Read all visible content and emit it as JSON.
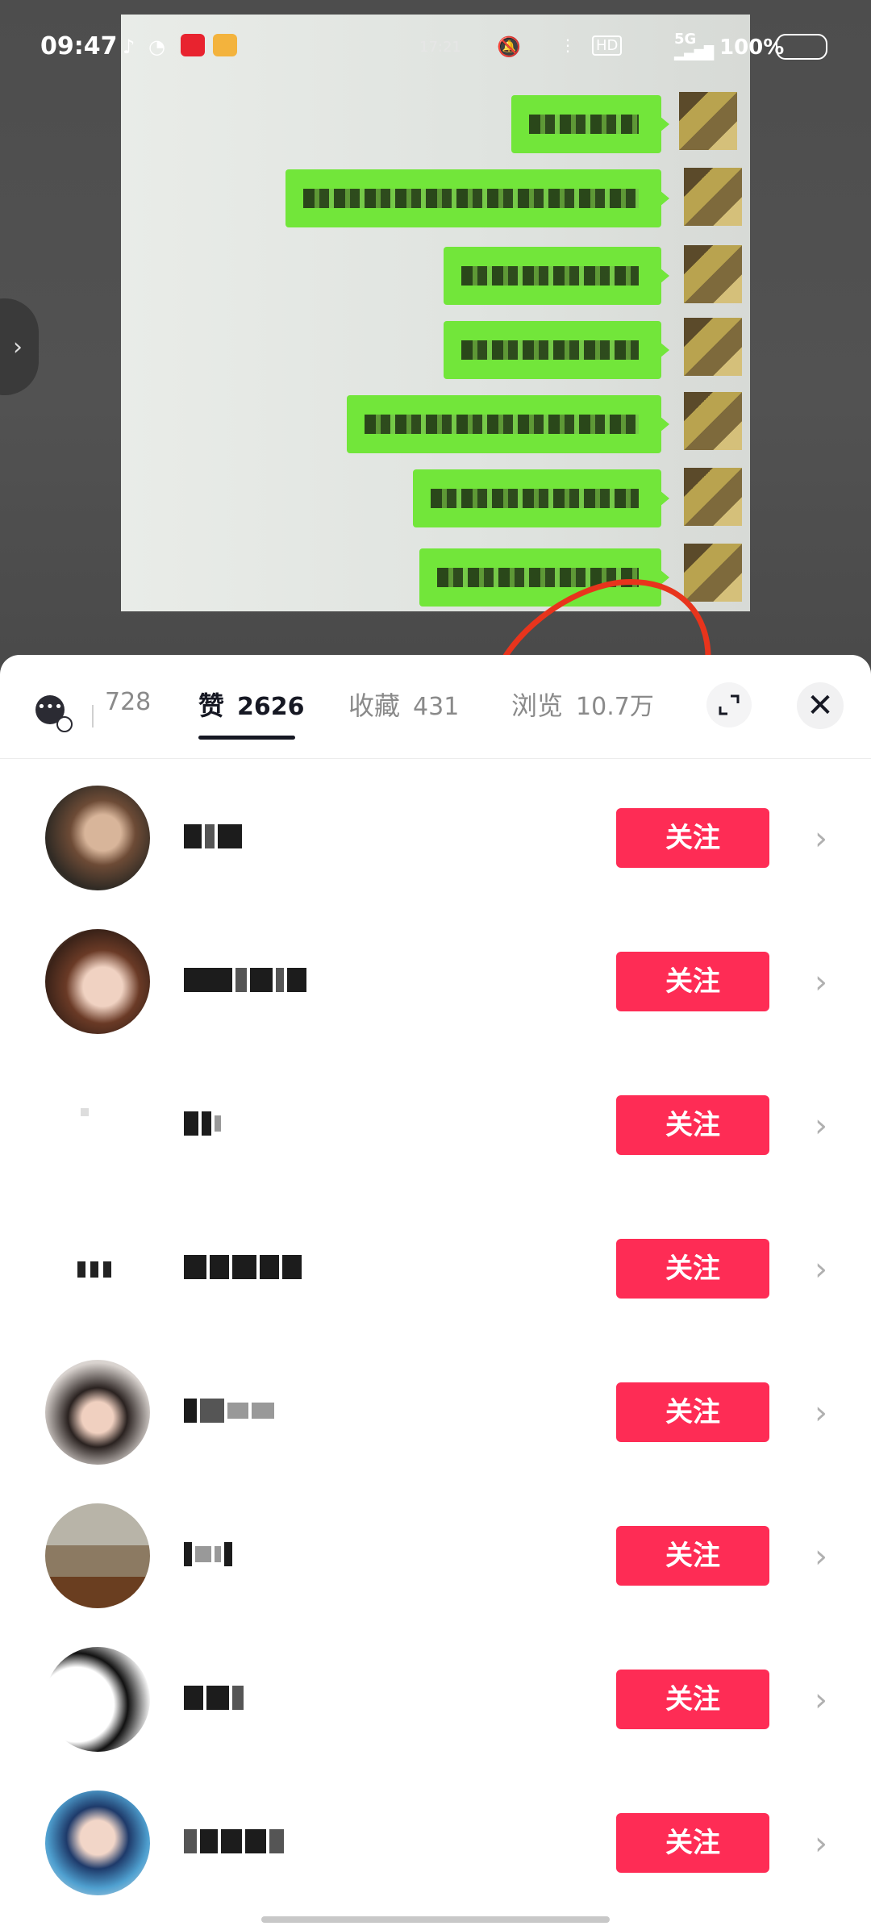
{
  "status_bar": {
    "time": "09:47",
    "center_time": "17:21",
    "network": "5G",
    "battery": "100%"
  },
  "tabs": [
    {
      "label": "",
      "count": "728",
      "active": false
    },
    {
      "label": "赞",
      "count": "2626",
      "active": true
    },
    {
      "label": "收藏",
      "count": "431",
      "active": false
    },
    {
      "label": "浏览",
      "count": "10.7万",
      "active": false
    }
  ],
  "users": [
    {
      "follow_label": "关注"
    },
    {
      "follow_label": "关注"
    },
    {
      "follow_label": "关注"
    },
    {
      "follow_label": "关注"
    },
    {
      "follow_label": "关注"
    },
    {
      "follow_label": "关注"
    },
    {
      "follow_label": "关注"
    },
    {
      "follow_label": "关注"
    }
  ],
  "colors": {
    "follow_button": "#fe2c55",
    "annotation_circle": "#e8341c",
    "chat_bubble": "#72e63a"
  },
  "icons": [
    "comment-settings-icon",
    "expand-icon",
    "close-icon",
    "chevron-right-icon"
  ]
}
